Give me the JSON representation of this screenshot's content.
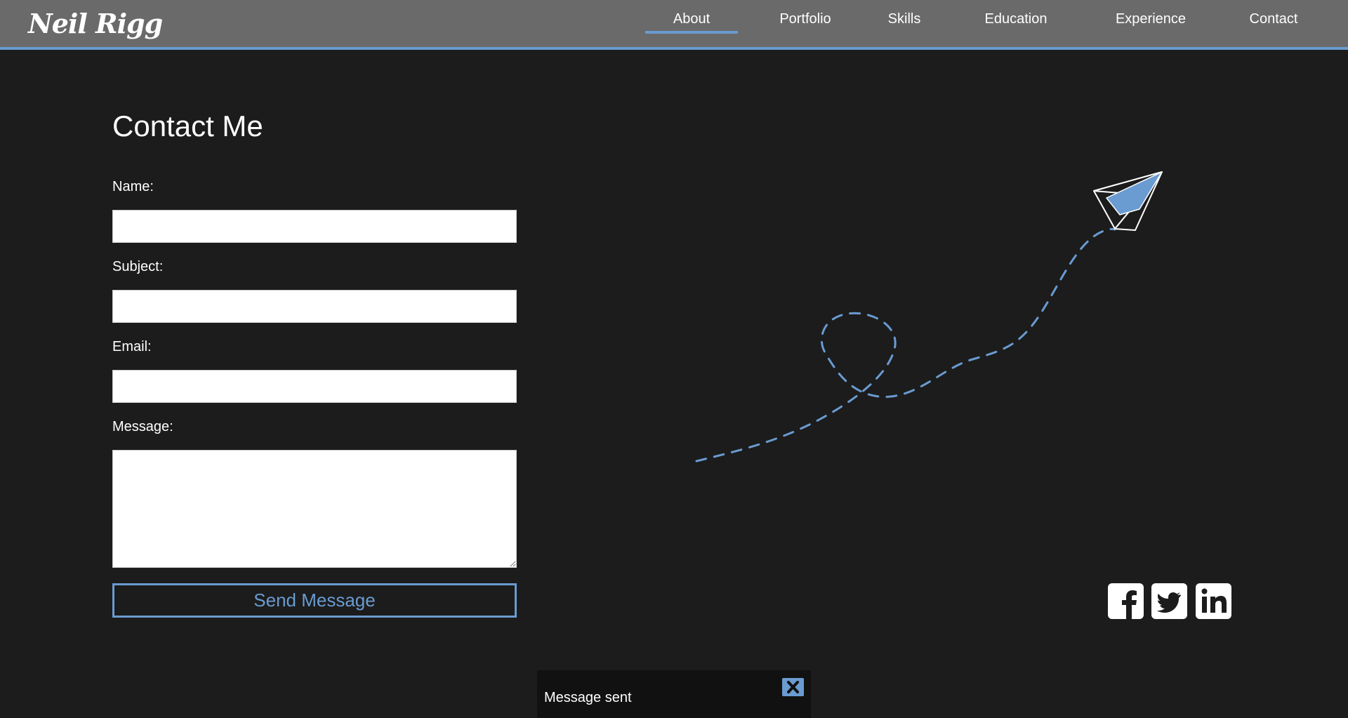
{
  "header": {
    "logo": "Neil Rigg",
    "nav": [
      "About",
      "Portfolio",
      "Skills",
      "Education",
      "Experience",
      "Contact"
    ],
    "active_nav": "About",
    "accent_color": "#6a9bd1"
  },
  "contact": {
    "title": "Contact Me",
    "name_label": "Name:",
    "subject_label": "Subject:",
    "email_label": "Email:",
    "message_label": "Message:",
    "name_value": "",
    "subject_value": "",
    "email_value": "",
    "message_value": "",
    "send_label": "Send Message"
  },
  "illustration": {
    "icon": "paper-plane-icon",
    "trail": "dashed-loop-trail"
  },
  "social": {
    "icons": [
      "facebook-icon",
      "twitter-icon",
      "linkedin-icon"
    ]
  },
  "toast": {
    "text": "Message sent",
    "close_icon": "close-icon"
  }
}
